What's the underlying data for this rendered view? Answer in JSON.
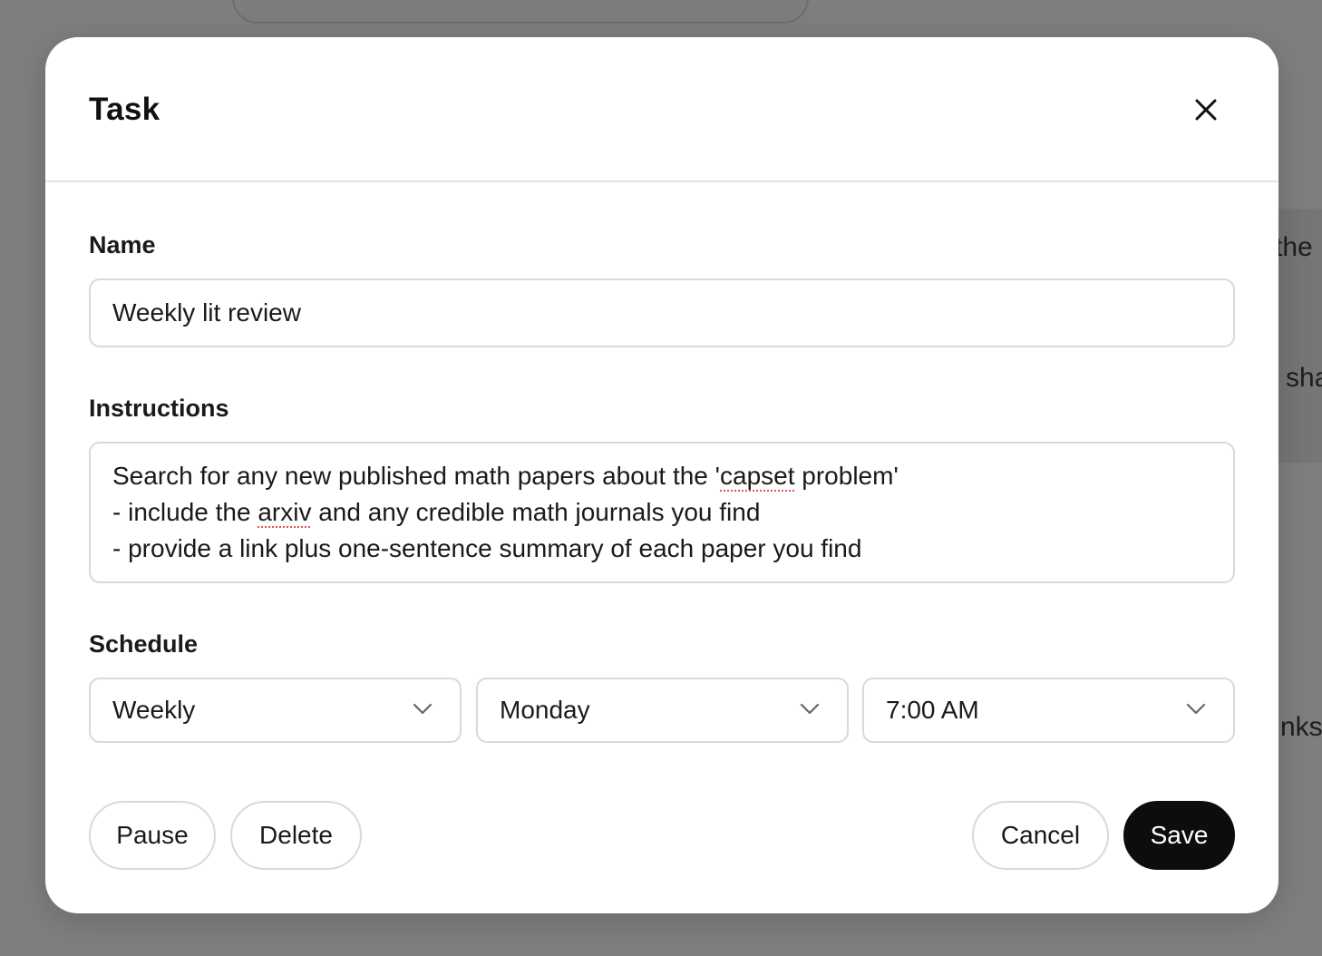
{
  "background": {
    "fragments": [
      "the",
      "sha",
      "nks"
    ]
  },
  "modal": {
    "title": "Task",
    "close_icon": "close-icon"
  },
  "form": {
    "name_label": "Name",
    "name_value": "Weekly lit review",
    "instructions_label": "Instructions",
    "instructions_lines": {
      "line1_before": "Search for any new published math papers about the '",
      "line1_misspelled": "capset",
      "line1_after": " problem'",
      "line2_before": "- include the ",
      "line2_misspelled": "arxiv",
      "line2_after": " and any credible math journals you find",
      "line3": "- provide a link plus one-sentence summary of each paper you find"
    },
    "schedule_label": "Schedule",
    "schedule": {
      "frequency": "Weekly",
      "day": "Monday",
      "time": "7:00 AM"
    }
  },
  "actions": {
    "pause_label": "Pause",
    "delete_label": "Delete",
    "cancel_label": "Cancel",
    "save_label": "Save"
  },
  "colors": {
    "overlay": "#7f7f7f",
    "primary_button": "#0d0d0d",
    "border": "#d9d9d9",
    "spellcheck_underline": "#e05252"
  }
}
